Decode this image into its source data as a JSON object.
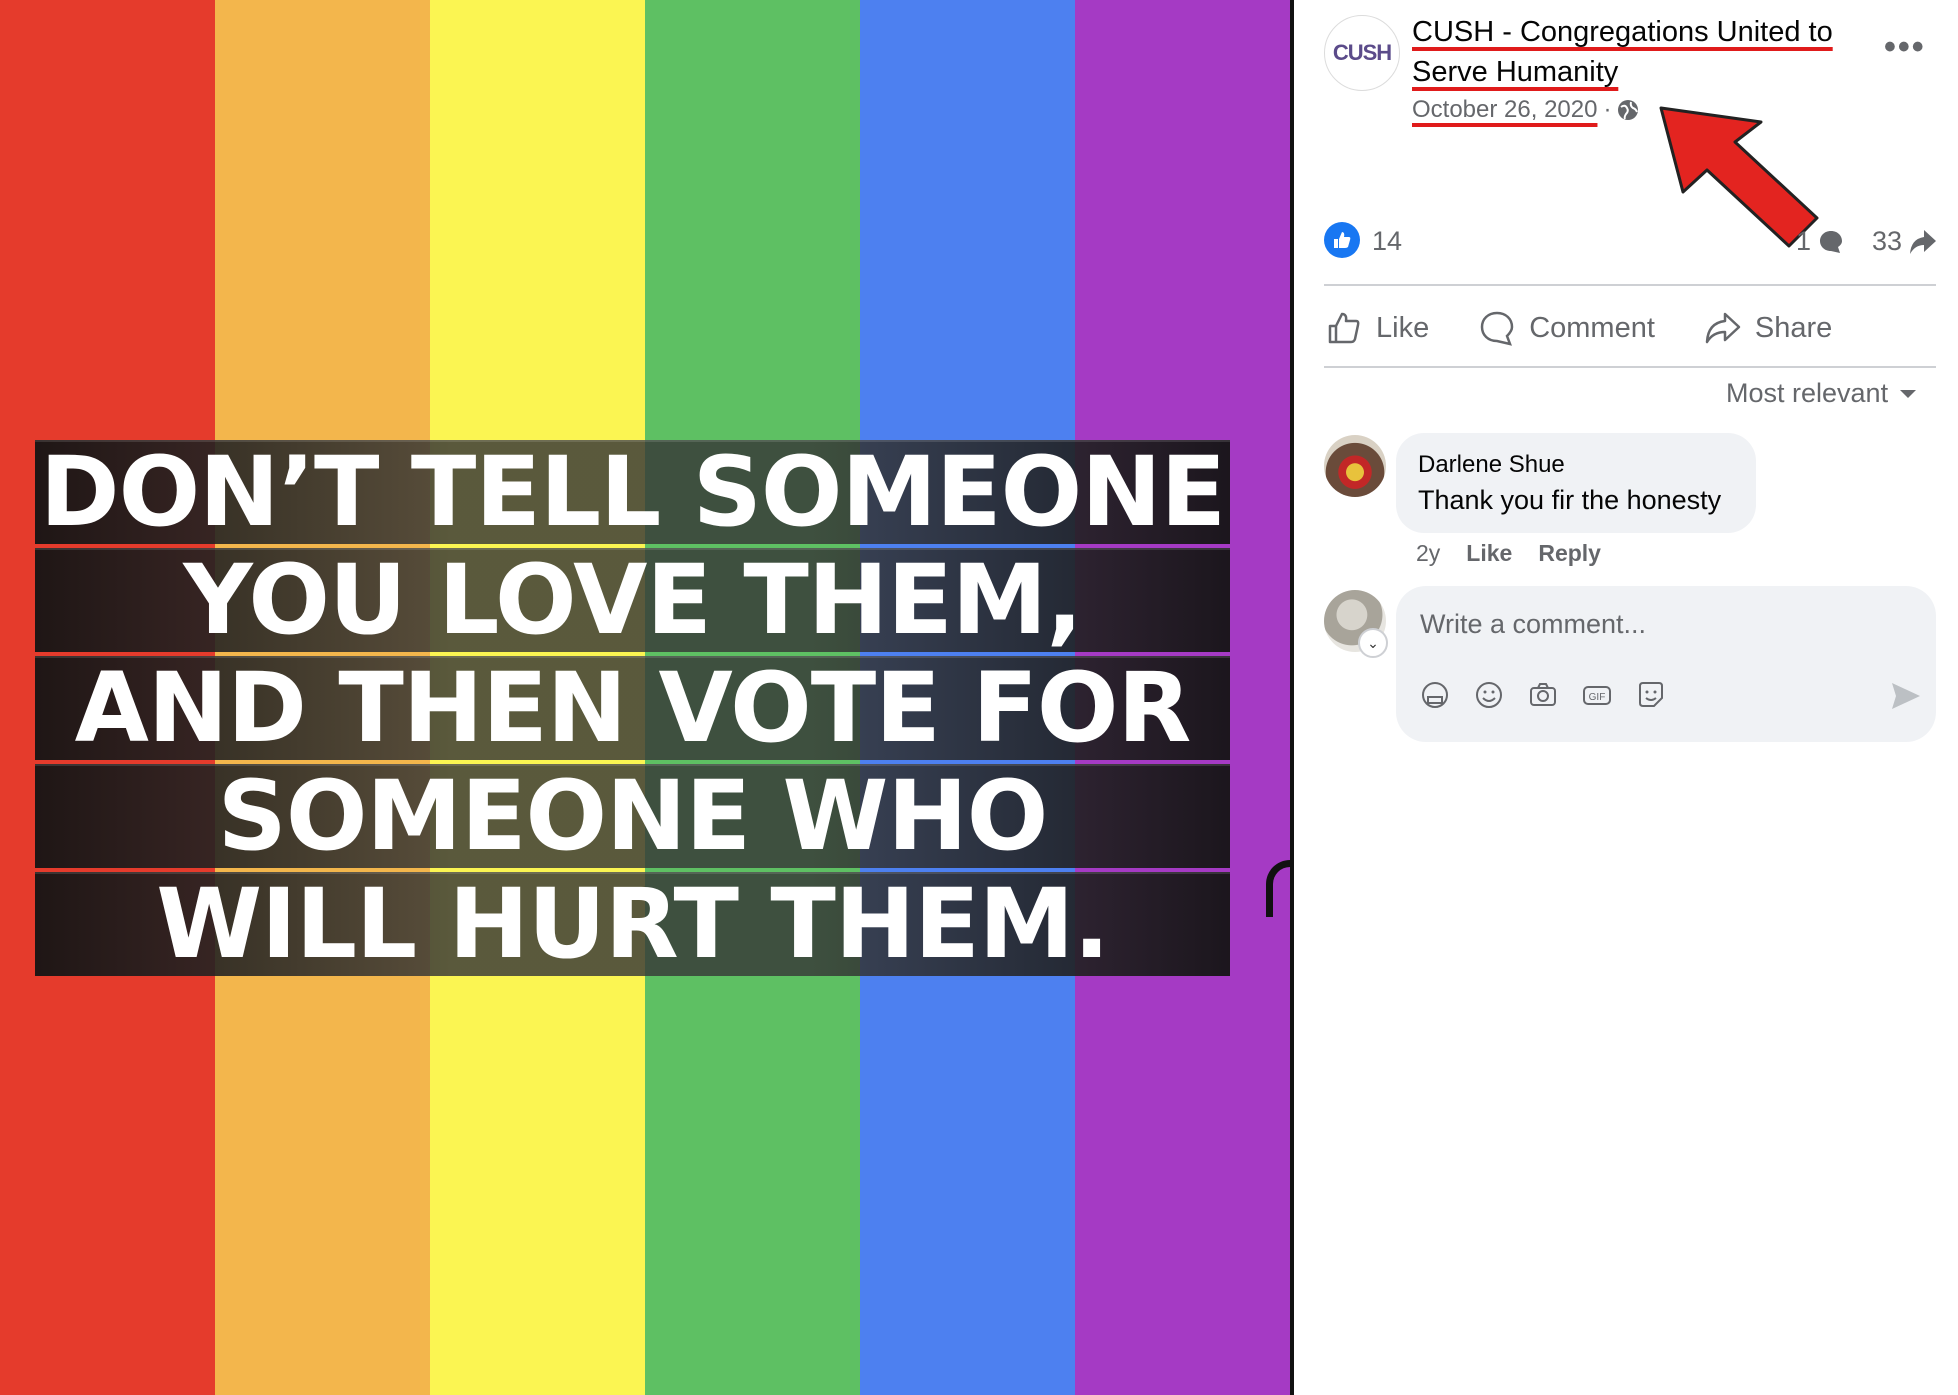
{
  "post_image": {
    "stripe_colors": [
      "#e53b2c",
      "#f3b64c",
      "#fbf552",
      "#5ec063",
      "#4d80f0",
      "#a53ac4"
    ],
    "quote_lines": [
      "DON’T TELL SOMEONE",
      "YOU LOVE THEM,",
      "AND THEN VOTE FOR",
      "SOMEONE WHO",
      "WILL HURT THEM."
    ]
  },
  "header": {
    "avatar_text": "CUSH",
    "page_name": "CUSH - Congregations United to Serve Humanity",
    "date": "October 26, 2020",
    "separator": "·",
    "audience_icon": "globe-icon",
    "more_label": "•••"
  },
  "annotation": {
    "arrow_color": "#e32420"
  },
  "reactions": {
    "reaction_icon": "thumbs-up-icon",
    "like_count": "14",
    "comment_count": "1",
    "share_count": "33"
  },
  "actions": {
    "like": "Like",
    "comment": "Comment",
    "share": "Share"
  },
  "sort": {
    "label": "Most relevant"
  },
  "comments": [
    {
      "author": "Darlene Shue",
      "text": "Thank you fir the honesty",
      "age": "2y",
      "like": "Like",
      "reply": "Reply"
    }
  ],
  "composer": {
    "placeholder": "Write a comment...",
    "tools": [
      "avatar-sticker-icon",
      "emoji-icon",
      "camera-icon",
      "gif-icon",
      "sticker-icon"
    ],
    "gif_label": "GIF"
  },
  "colors": {
    "brand_blue": "#1877f2",
    "muted_text": "#65676b",
    "underline_red": "#e01b1b"
  }
}
